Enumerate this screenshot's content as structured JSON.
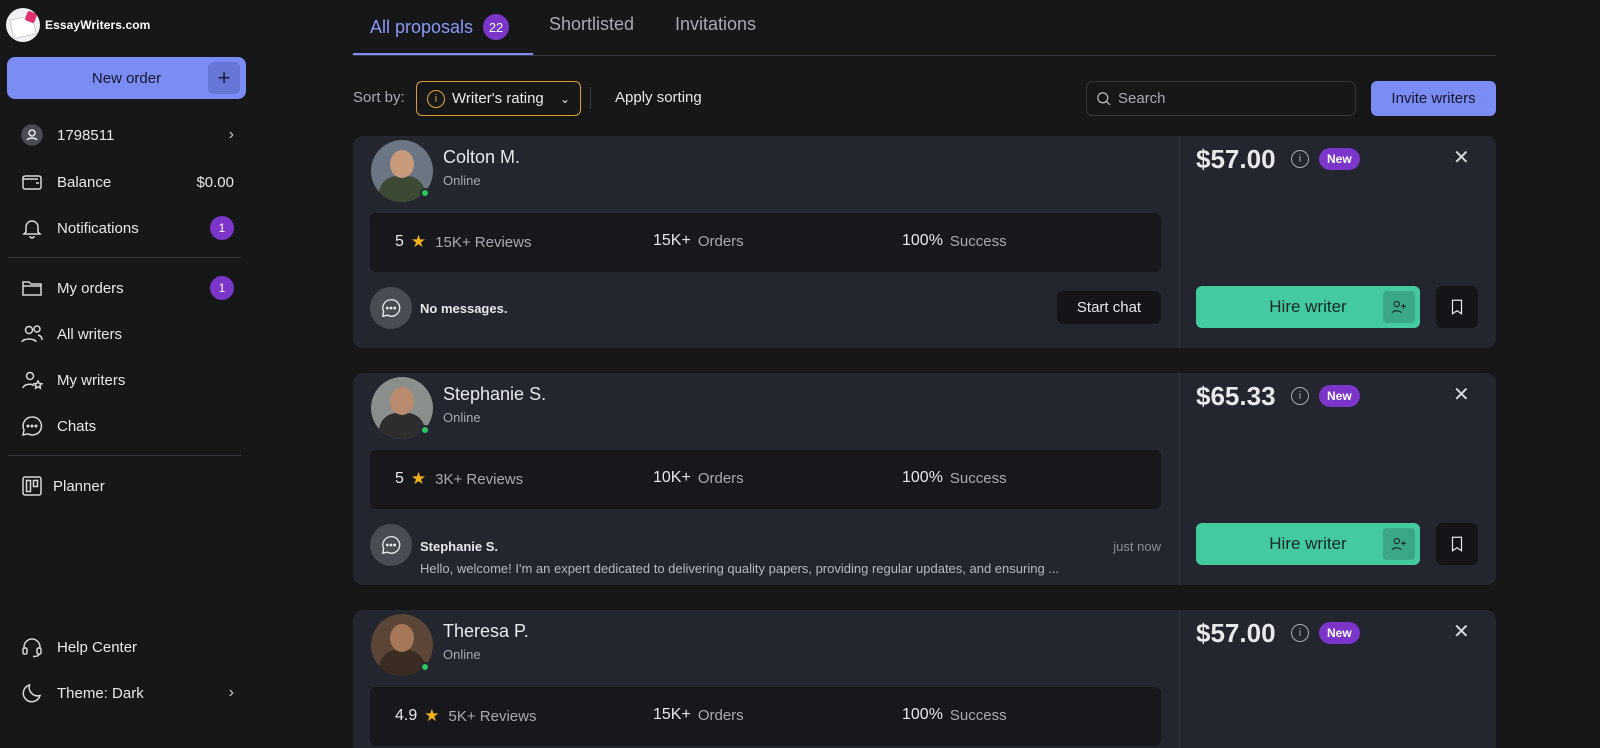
{
  "brand": {
    "name": "EssayWriters.com"
  },
  "sidebar": {
    "new_order": "New order",
    "user_id": "1798511",
    "balance_label": "Balance",
    "balance_value": "$0.00",
    "notifications_label": "Notifications",
    "notifications_count": "1",
    "my_orders_label": "My orders",
    "my_orders_count": "1",
    "all_writers_label": "All writers",
    "my_writers_label": "My writers",
    "chats_label": "Chats",
    "planner_label": "Planner",
    "help_label": "Help Center",
    "theme_label": "Theme: Dark"
  },
  "tabs": {
    "all_proposals": "All proposals",
    "all_proposals_count": "22",
    "shortlisted": "Shortlisted",
    "invitations": "Invitations"
  },
  "toolbar": {
    "sort_by": "Sort by:",
    "sort_value": "Writer's rating",
    "apply_sorting": "Apply sorting",
    "search_placeholder": "Search",
    "invite_writers": "Invite writers"
  },
  "cards": [
    {
      "name": "Colton M.",
      "status": "Online",
      "rating": "5",
      "reviews": "15K+ Reviews",
      "orders_num": "15K+",
      "orders_label": "Orders",
      "success_num": "100%",
      "success_label": "Success",
      "message_empty": "No messages.",
      "start_chat": "Start chat",
      "price": "$57.00",
      "badge": "New",
      "hire": "Hire writer"
    },
    {
      "name": "Stephanie S.",
      "status": "Online",
      "rating": "5",
      "reviews": "3K+ Reviews",
      "orders_num": "10K+",
      "orders_label": "Orders",
      "success_num": "100%",
      "success_label": "Success",
      "message_from": "Stephanie S.",
      "message_time": "just now",
      "message_text": "Hello, welcome! I'm an expert dedicated to delivering quality papers, providing regular updates, and ensuring ...",
      "price": "$65.33",
      "badge": "New",
      "hire": "Hire writer"
    },
    {
      "name": "Theresa P.",
      "status": "Online",
      "rating": "4.9",
      "reviews": "5K+ Reviews",
      "orders_num": "15K+",
      "orders_label": "Orders",
      "success_num": "100%",
      "success_label": "Success",
      "price": "$57.00",
      "badge": "New"
    }
  ],
  "colors": {
    "accent": "#7b8cf5",
    "hire_green": "#44c9a0",
    "badge_purple": "#7c35c9",
    "sort_orange": "#e19a2e",
    "online_green": "#2cc55e"
  }
}
